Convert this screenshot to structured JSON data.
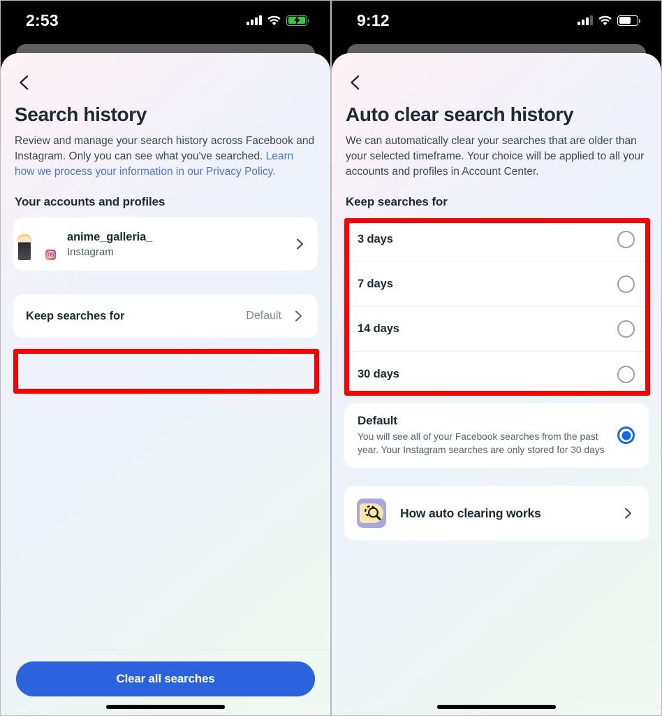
{
  "left": {
    "status": {
      "time": "2:53",
      "signal_icon": "signal-bars-icon",
      "signal_bars": 4,
      "wifi_icon": "wifi-icon",
      "battery_icon": "battery-charging-icon",
      "battery_state": "charging",
      "battery_color": "#31cb45"
    },
    "nav": {
      "back_icon": "chevron-left-icon"
    },
    "title": "Search history",
    "description_plain": "Review and manage your search history across Facebook and Instagram. Only you can see what you've searched. ",
    "description_link": "Learn how we process your information in our Privacy Policy.",
    "link_color": "#4676e8",
    "section_label": "Your accounts and profiles",
    "account": {
      "name": "anime_galleria_",
      "platform": "Instagram",
      "avatar_icon": "avatar",
      "badge_icon": "instagram-badge-icon",
      "chevron_icon": "chevron-right-icon"
    },
    "keep_row": {
      "label": "Keep searches for",
      "value": "Default",
      "chevron_icon": "chevron-right-icon"
    },
    "cta": "Clear all searches",
    "cta_color": "#2b62dd"
  },
  "right": {
    "status": {
      "time": "9:12",
      "signal_icon": "signal-bars-icon",
      "signal_bars": 3,
      "wifi_icon": "wifi-icon",
      "battery_icon": "battery-icon",
      "battery_state": "normal",
      "battery_color": "#ffffff"
    },
    "nav": {
      "back_icon": "chevron-left-icon"
    },
    "title": "Auto clear search history",
    "description": "We can automatically clear your searches that are older than your selected timeframe. Your choice will be applied to all your accounts and profiles in Account Center.",
    "section_label": "Keep searches for",
    "options": [
      {
        "label": "3 days",
        "selected": false
      },
      {
        "label": "7 days",
        "selected": false
      },
      {
        "label": "14 days",
        "selected": false
      },
      {
        "label": "30 days",
        "selected": false
      }
    ],
    "default_option": {
      "title": "Default",
      "description": "You will see all of your Facebook searches from the past year. Your Instagram searches are only stored for 30 days",
      "selected": true,
      "selected_color": "#1666e8"
    },
    "how_row": {
      "label": "How auto clearing works",
      "icon": "magnifier-auto-clear-icon",
      "chevron_icon": "chevron-right-icon"
    }
  },
  "annotations": {
    "highlight_color": "#fe0000",
    "boxes": [
      {
        "name": "keep-searches-for-highlight",
        "screen": "left"
      },
      {
        "name": "days-options-highlight",
        "screen": "right"
      }
    ]
  }
}
